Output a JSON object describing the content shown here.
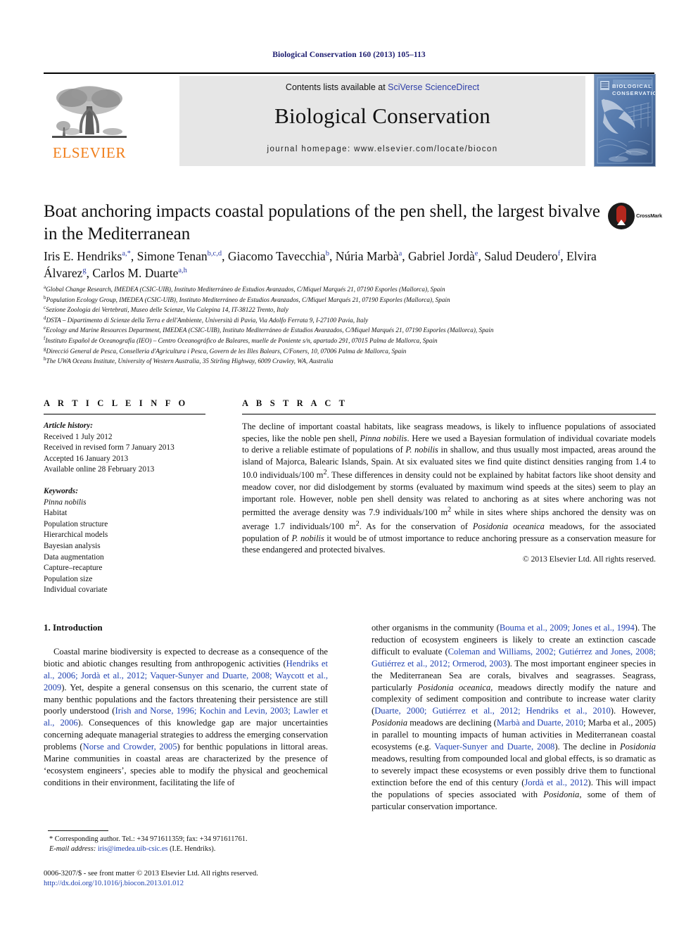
{
  "running_head": "Biological Conservation 160 (2013) 105–113",
  "masthead": {
    "contents_prefix": "Contents lists available at ",
    "sciencedirect": "SciVerse ScienceDirect",
    "journal_title": "Biological Conservation",
    "homepage": "journal homepage: www.elsevier.com/locate/biocon",
    "publisher_logo_text": "ELSEVIER",
    "cover_title_line1": "BIOLOGICAL",
    "cover_title_line2": "CONSERVATION",
    "colors": {
      "elsevier_orange": "#f07d18",
      "link_blue": "#2f3fa8",
      "masthead_grey": "#e6e6e6",
      "cover_blue": "#5c7fb0"
    }
  },
  "article": {
    "title": "Boat anchoring impacts coastal populations of the pen shell, the largest bivalve in the Mediterranean",
    "crossmark_label": "CrossMark",
    "authors": [
      {
        "name": "Iris E. Hendriks",
        "marks": "a,*"
      },
      {
        "name": "Simone Tenan",
        "marks": "b,c,d"
      },
      {
        "name": "Giacomo Tavecchia",
        "marks": "b"
      },
      {
        "name": "Núria Marbà",
        "marks": "a"
      },
      {
        "name": "Gabriel Jordà",
        "marks": "e"
      },
      {
        "name": "Salud Deudero",
        "marks": "f"
      },
      {
        "name": "Elvira Álvarez",
        "marks": "g"
      },
      {
        "name": "Carlos M. Duarte",
        "marks": "a,h"
      }
    ],
    "affiliations": [
      {
        "mark": "a",
        "text": "Global Change Research, IMEDEA (CSIC-UIB), Instituto Mediterráneo de Estudios Avanzados, C/Miquel Marqués 21, 07190 Esporles (Mallorca), Spain"
      },
      {
        "mark": "b",
        "text": "Population Ecology Group, IMEDEA (CSIC-UIB), Instituto Mediterráneo de Estudios Avanzados, C/Miquel Marqués 21, 07190 Esporles (Mallorca), Spain"
      },
      {
        "mark": "c",
        "text": "Sezione Zoologia dei Vertebrati, Museo delle Scienze, Via Calepina 14, IT-38122 Trento, Italy"
      },
      {
        "mark": "d",
        "text": "DSTA – Dipartimento di Scienze della Terra e dell'Ambiente, Università di Pavia, Via Adolfo Ferrata 9, I-27100 Pavia, Italy"
      },
      {
        "mark": "e",
        "text": "Ecology and Marine Resources Department, IMEDEA (CSIC-UIB), Instituto Mediterráneo de Estudios Avanzados, C/Miquel Marqués 21, 07190 Esporles (Mallorca), Spain"
      },
      {
        "mark": "f",
        "text": "Instituto Español de Oceanografía (IEO) – Centro Oceanográfico de Baleares, muelle de Poniente s/n, apartado 291, 07015 Palma de Mallorca, Spain"
      },
      {
        "mark": "g",
        "text": "Direcció General de Pesca, Conselleria d'Agricultura i Pesca, Govern de les Illes Balears, C/Foners, 10, 07006 Palma de Mallorca, Spain"
      },
      {
        "mark": "h",
        "text": "The UWA Oceans Institute, University of Western Australia, 35 Stirling Highway, 6009 Crawley, WA, Australia"
      }
    ]
  },
  "article_info": {
    "heading": "A R T I C L E    I N F O",
    "history_label": "Article history:",
    "history": [
      "Received 1 July 2012",
      "Received in revised form 7 January 2013",
      "Accepted 16 January 2013",
      "Available online 28 February 2013"
    ],
    "keywords_label": "Keywords:",
    "keywords": [
      "Pinna nobilis",
      "Habitat",
      "Population structure",
      "Hierarchical models",
      "Bayesian analysis",
      "Data augmentation",
      "Capture–recapture",
      "Population size",
      "Individual covariate"
    ]
  },
  "abstract": {
    "heading": "A B S T R A C T",
    "copyright": "© 2013 Elsevier Ltd. All rights reserved."
  },
  "introduction": {
    "section_title": "1. Introduction"
  },
  "footnote": {
    "corresponding": "* Corresponding author. Tel.: +34 971611359; fax: +34 971611761.",
    "email_label": "E-mail address:",
    "email": "iris@imedea.uib-csic.es",
    "email_owner": "(I.E. Hendriks)."
  },
  "footer": {
    "issn_line": "0006-3207/$ - see front matter © 2013 Elsevier Ltd. All rights reserved.",
    "doi": "http://dx.doi.org/10.1016/j.biocon.2013.01.012"
  }
}
